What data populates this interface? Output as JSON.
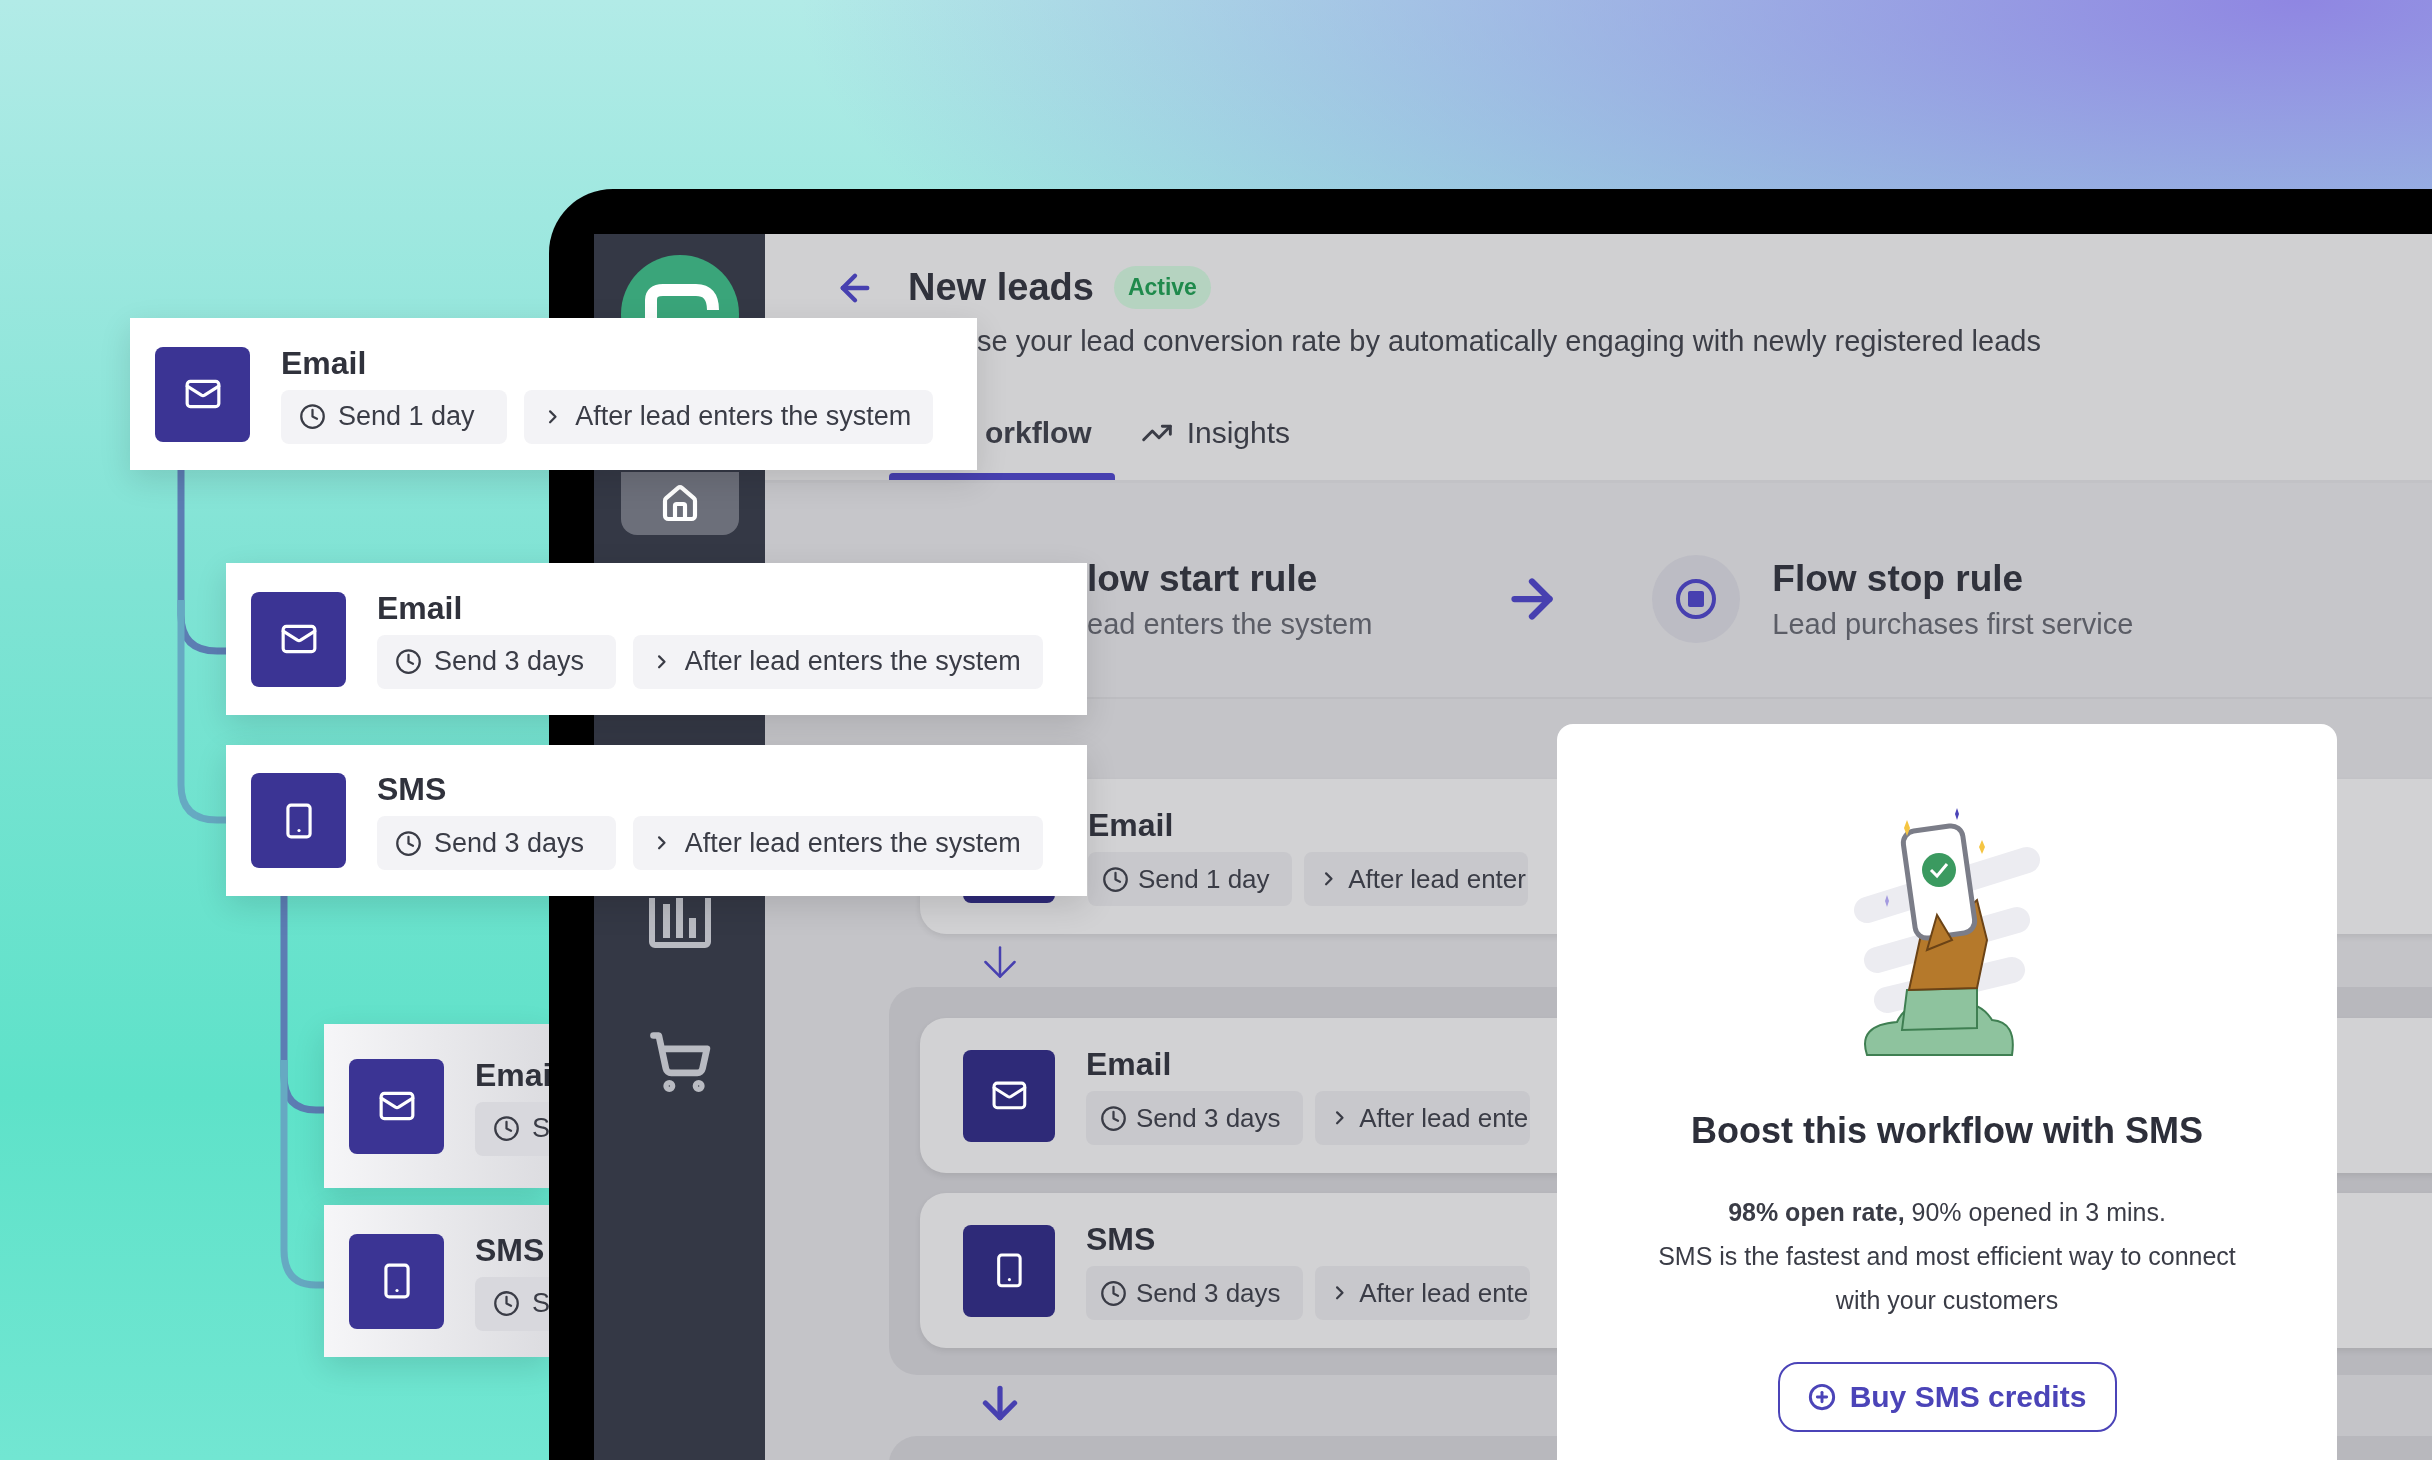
{
  "floating_steps": [
    {
      "kind": "email",
      "title": "Email",
      "delay": "Send 1 day",
      "trigger": "After lead enters the system"
    },
    {
      "kind": "email",
      "title": "Email",
      "delay": "Send 3 days",
      "trigger": "After lead enters the system"
    },
    {
      "kind": "sms",
      "title": "SMS",
      "delay": "Send 3 days",
      "trigger": "After lead enters the system"
    },
    {
      "kind": "email",
      "title": "Emai",
      "delay": "S"
    },
    {
      "kind": "sms",
      "title": "SMS",
      "delay": "S"
    }
  ],
  "app": {
    "header": {
      "title": "New leads",
      "status": "Active",
      "description": "se your lead conversion rate by automatically engaging with newly registered leads"
    },
    "tabs": [
      {
        "label": "orkflow",
        "selected": true
      },
      {
        "label": "Insights",
        "selected": false
      }
    ],
    "rules": {
      "start": {
        "title": "low start rule",
        "subtitle": "ead enters the system"
      },
      "stop": {
        "title": "Flow stop rule",
        "subtitle": "Lead purchases first service"
      }
    },
    "first_step": {
      "title": "Email",
      "delay": "Send 1 day",
      "trigger": "After lead enter"
    },
    "grouped_steps": [
      {
        "kind": "email",
        "title": "Email",
        "delay": "Send 3 days",
        "trigger": "After lead ente"
      },
      {
        "kind": "sms",
        "title": "SMS",
        "delay": "Send 3 days",
        "trigger": "After lead ente"
      }
    ],
    "promo": {
      "title": "Boost this workflow with SMS",
      "lead": "**98% open rate,** 90% opened in 3 mins.",
      "body": "SMS is the fastest and most efficient way to connect with your customers",
      "button": "Buy SMS credits"
    }
  }
}
